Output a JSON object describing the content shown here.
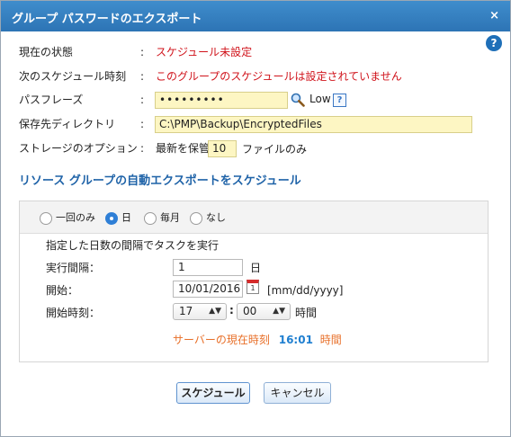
{
  "dialog": {
    "title": "グループ パスワードのエクスポート",
    "close_glyph": "×",
    "help_glyph": "?"
  },
  "fields": {
    "status": {
      "label": "現在の状態",
      "value": "スケジュール未設定"
    },
    "next_schedule": {
      "label": "次のスケジュール時刻",
      "value": "このグループのスケジュールは設定されていません"
    },
    "passphrase": {
      "label": "パスフレーズ",
      "value": "•••••••••",
      "strength": "Low",
      "help_glyph": "?"
    },
    "directory": {
      "label": "保存先ディレクトリ",
      "value": "C:\\PMP\\Backup\\EncryptedFiles"
    },
    "storage": {
      "label": "ストレージのオプション",
      "prefix": "最新を保管",
      "count": "10",
      "suffix": "ファイルのみ"
    },
    "colon": ":"
  },
  "section": {
    "title": "リソース グループの自動エクスポートをスケジュール"
  },
  "schedule": {
    "options": [
      {
        "label": "一回のみ",
        "selected": false
      },
      {
        "label": "日",
        "selected": true
      },
      {
        "label": "毎月",
        "selected": false
      },
      {
        "label": "なし",
        "selected": false
      }
    ],
    "description": "指定した日数の間隔でタスクを実行",
    "interval": {
      "label": "実行間隔：",
      "value": "1",
      "unit": "日"
    },
    "start": {
      "label": "開始：",
      "value": "10/01/2016",
      "format": "[mm/dd/yyyy]",
      "calendar_day": "1"
    },
    "start_time": {
      "label": "開始時刻：",
      "hour": "17",
      "minute": "00",
      "separator": ":",
      "unit": "時間"
    },
    "server_time": {
      "label": "サーバーの現在時刻",
      "time": "16:01",
      "unit": "時間"
    }
  },
  "buttons": {
    "schedule": "スケジュール",
    "cancel": "キャンセル"
  },
  "colors": {
    "title_bar": "#2d74b5",
    "accent_red": "#d0131b",
    "accent_blue": "#1f63a8",
    "server_time_orange": "#e8702a"
  }
}
